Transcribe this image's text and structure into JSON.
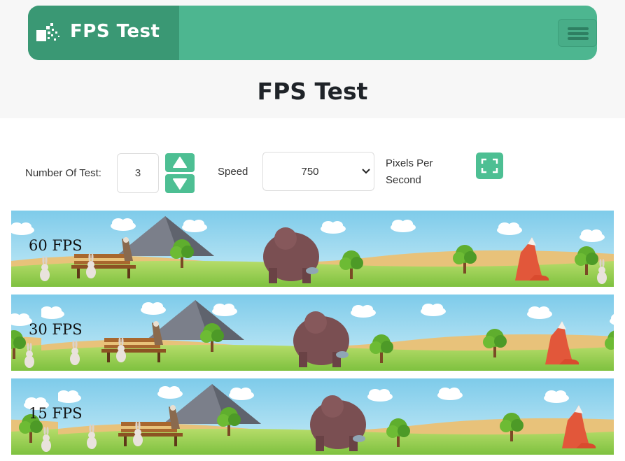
{
  "brand": {
    "name": "FPS Test",
    "logo_icon": "pixel-logo-icon"
  },
  "nav": {
    "menu_icon": "hamburger-menu-icon"
  },
  "page": {
    "title": "FPS Test"
  },
  "controls": {
    "number_of_test_label": "Number Of Test:",
    "number_of_test_value": "3",
    "increment_icon": "triangle-up-icon",
    "decrement_icon": "triangle-down-icon",
    "speed_label": "Speed",
    "speed_value": "750",
    "pixels_per_second_label_line1": "Pixels Per",
    "pixels_per_second_label_line2": "Second",
    "fullscreen_icon": "fullscreen-icon"
  },
  "lanes": [
    {
      "label": "60 FPS"
    },
    {
      "label": "30 FPS"
    },
    {
      "label": "15 FPS"
    }
  ],
  "colors": {
    "accent": "#4db690",
    "accent_dark": "#3a9874",
    "button": "#4dbf93"
  }
}
